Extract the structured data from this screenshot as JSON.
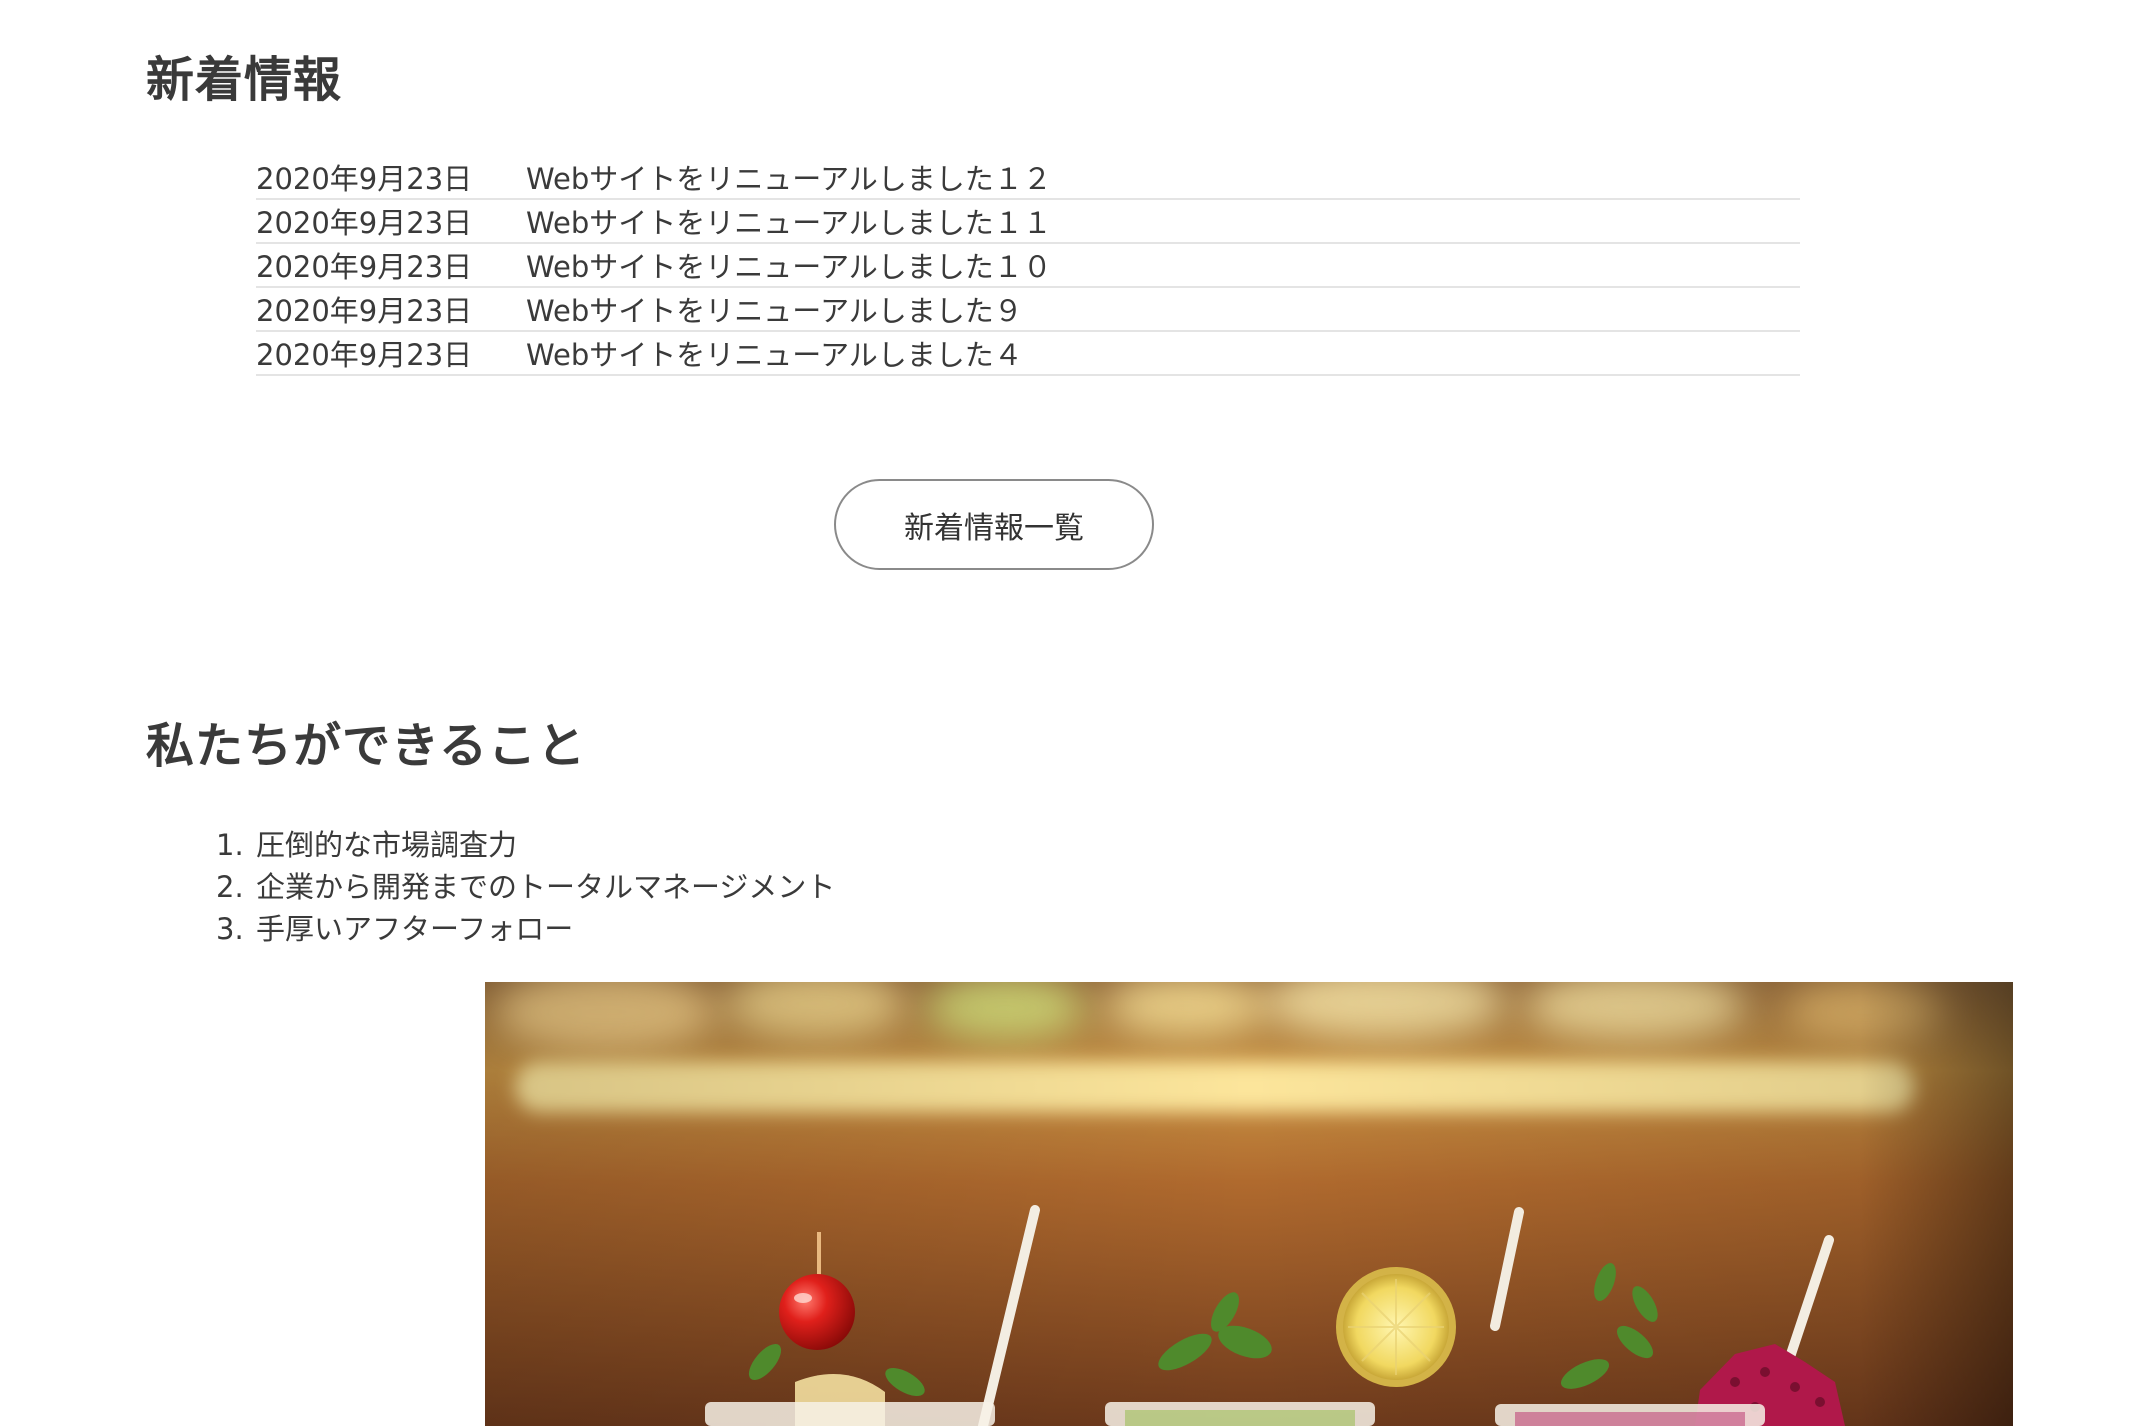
{
  "news": {
    "title": "新着情報",
    "items": [
      {
        "date": "2020年9月23日",
        "text": "Webサイトをリニューアルしました１２"
      },
      {
        "date": "2020年9月23日",
        "text": "Webサイトをリニューアルしました１１"
      },
      {
        "date": "2020年9月23日",
        "text": "Webサイトをリニューアルしました１０"
      },
      {
        "date": "2020年9月23日",
        "text": "Webサイトをリニューアルしました９"
      },
      {
        "date": "2020年9月23日",
        "text": "Webサイトをリニューアルしました４"
      }
    ],
    "more_label": "新着情報一覧"
  },
  "services": {
    "title": "私たちができること",
    "items": [
      {
        "number": "1.",
        "label": "圧倒的な市場調査力"
      },
      {
        "number": "2.",
        "label": "企業から開発までのトータルマネージメント"
      },
      {
        "number": "3.",
        "label": "手厚いアフターフォロー"
      }
    ]
  },
  "colors": {
    "heading": "#3a3a3a",
    "text": "#3a3a3a",
    "divider": "#e4e4e4",
    "button_border": "#8a8a8a"
  }
}
